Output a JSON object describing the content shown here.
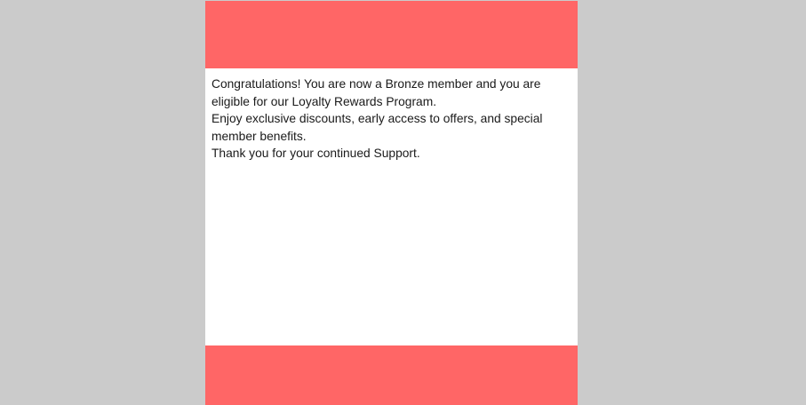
{
  "colors": {
    "background": "#cbcbcb",
    "card": "#ffffff",
    "accent_band": "#ff6666",
    "text": "#1a1a1a"
  },
  "message": {
    "line1": "Congratulations! You are now a Bronze member and you are eligible for our Loyalty Rewards Program.",
    "line2": "Enjoy exclusive discounts, early access to offers, and special member benefits.",
    "line3": "Thank you for your continued Support."
  }
}
